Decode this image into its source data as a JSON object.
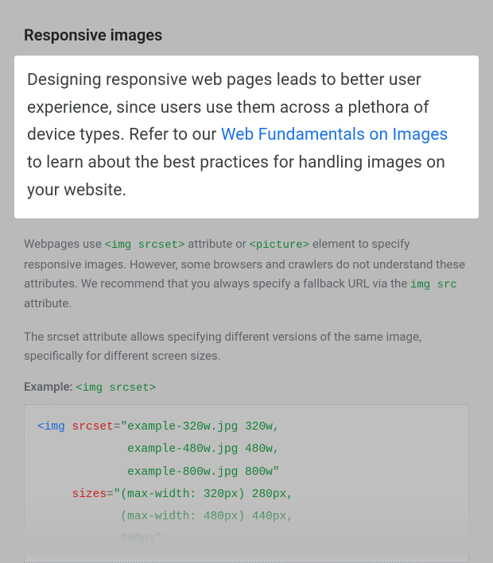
{
  "heading": "Responsive images",
  "highlight": {
    "prefix": "Designing responsive web pages leads to better user experience, since users use them across a plethora of device types. Refer to our ",
    "link_text": "Web Fundamentals on Images",
    "suffix": " to learn about the best practices for handling images on your website."
  },
  "para1": {
    "t1": "Webpages use ",
    "c1": "<img srcset>",
    "t2": " attribute or ",
    "c2": "<picture>",
    "t3": " element to specify responsive images. However, some browsers and crawlers do not understand these attributes. We recommend that you always specify a fallback URL via the ",
    "c3": "img src",
    "t4": " attribute."
  },
  "para2": "The srcset attribute allows specifying different versions of the same image, specifically for different screen sizes.",
  "example": {
    "label": "Example:",
    "code": "<img srcset>"
  },
  "code": {
    "l1_tag": "<img",
    "l1_attr": " srcset",
    "l1_eq": "=",
    "l1_str": "\"example-320w.jpg 320w,",
    "l2_str": "             example-480w.jpg 480w,",
    "l3_str": "             example-800w.jpg 800w\"",
    "l4_attr": "     sizes",
    "l4_eq": "=",
    "l4_str": "\"(max-width: 320px) 280px,",
    "l5_str": "            (max-width: 480px) 440px,",
    "l6_str": "            800px\""
  }
}
